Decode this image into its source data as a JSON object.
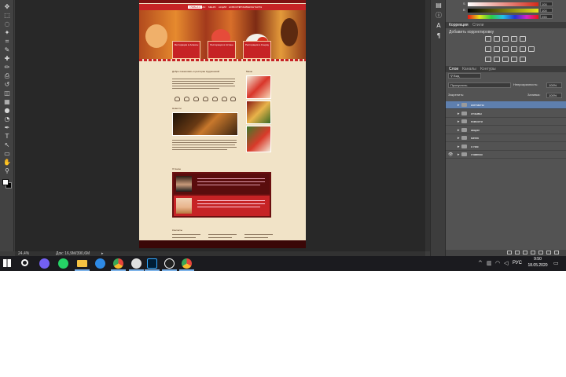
{
  "app": {
    "name": "Adobe Photoshop",
    "zoom": "24,4%",
    "doc_size": "Док: 16,9M/390,6M",
    "status_arrow": "▸"
  },
  "tools": [
    "move-icon",
    "marquee-icon",
    "lasso-icon",
    "magic-wand-icon",
    "crop-icon",
    "eyedropper-icon",
    "heal-icon",
    "brush-icon",
    "stamp-icon",
    "history-brush-icon",
    "eraser-icon",
    "gradient-icon",
    "blur-icon",
    "dodge-icon",
    "pen-icon",
    "type-icon",
    "path-select-icon",
    "shape-icon",
    "hand-icon",
    "zoom-icon"
  ],
  "tool_glyphs": [
    "✥",
    "⬚",
    "◌",
    "✦",
    "⌗",
    "✎",
    "✚",
    "✏",
    "⎙",
    "↺",
    "◫",
    "▦",
    "●",
    "◔",
    "✒",
    "T",
    "↖",
    "▭",
    "✋",
    "⚲"
  ],
  "mid_icons": [
    {
      "name": "history-icon",
      "glyph": "▤"
    },
    {
      "name": "info-icon",
      "glyph": "ⓘ"
    },
    {
      "name": "character-icon",
      "glyph": "A"
    },
    {
      "name": "paragraph-icon",
      "glyph": "¶"
    }
  ],
  "color_panel": {
    "fields": [
      {
        "label": "S",
        "value": "100",
        "gradient": "linear-gradient(90deg,#ffffff,#d42a1a)"
      },
      {
        "label": "B",
        "value": "100",
        "gradient": "linear-gradient(90deg,#000000,#e5e51a)"
      },
      {
        "label": "",
        "value": "255",
        "gradient": "linear-gradient(90deg,#e81515,#e5e519,#2ecc40,#21c1e8,#2233d4,#d622c8,#e81515)"
      }
    ]
  },
  "adjustments": {
    "tabs": [
      "Коррекция",
      "Стили"
    ],
    "title": "Добавить корректировку"
  },
  "layers_panel": {
    "tabs": [
      "Слои",
      "Каналы",
      "Контуры"
    ],
    "filter_kind": "Вид",
    "blend_mode": "Пропустить",
    "opacity_label": "Непрозрачность:",
    "opacity_value": "100%",
    "lock_label": "Закрепить:",
    "fill_label": "Заливка:",
    "fill_value": "100%",
    "layers": [
      {
        "name": "контакты",
        "selected": true,
        "eye": ""
      },
      {
        "name": "отзывы",
        "selected": false,
        "eye": ""
      },
      {
        "name": "новости",
        "selected": false,
        "eye": ""
      },
      {
        "name": "акции",
        "selected": false,
        "eye": ""
      },
      {
        "name": "меню",
        "selected": false,
        "eye": ""
      },
      {
        "name": "о нас",
        "selected": false,
        "eye": ""
      },
      {
        "name": "главная",
        "selected": false,
        "eye": "👁"
      }
    ]
  },
  "document": {
    "nav": [
      "ГЛАВНАЯ",
      "О НАС",
      "МЕНЮ",
      "АКЦИИ",
      "НОВОСТИ",
      "ОТЗЫВЫ",
      "КОНТАКТЫ"
    ],
    "hero_cards": [
      "Ресторация в Алматы",
      "Ресторация в Астане",
      "Ресторация в Атырау"
    ],
    "about_title": "Добро пожаловать в ресторан Кудряшовой",
    "menu_title": "Меню",
    "news_title": "Новости",
    "reviews_title": "Отзывы",
    "contacts_title": "Контакты"
  },
  "taskbar": {
    "apps": [
      {
        "name": "windows-start-icon",
        "color": "#ffffff"
      },
      {
        "name": "search-icon",
        "color": "#ffffff"
      },
      {
        "name": "viber-icon",
        "color": "#7360f2"
      },
      {
        "name": "whatsapp-icon",
        "color": "#25d366"
      },
      {
        "name": "file-explorer-icon",
        "color": "#f5c242"
      },
      {
        "name": "edge-icon",
        "color": "#2e8ae6"
      },
      {
        "name": "chrome-icon",
        "color": "#e8453c"
      },
      {
        "name": "inkscape-icon",
        "color": "#e0e0e0"
      },
      {
        "name": "photoshop-icon",
        "color": "#31a8ff"
      },
      {
        "name": "info-app-icon",
        "color": "#ffffff"
      },
      {
        "name": "chrome-2-icon",
        "color": "#e8453c"
      }
    ],
    "language": "РУС",
    "time": "9:50",
    "date": "18.05.2020"
  }
}
